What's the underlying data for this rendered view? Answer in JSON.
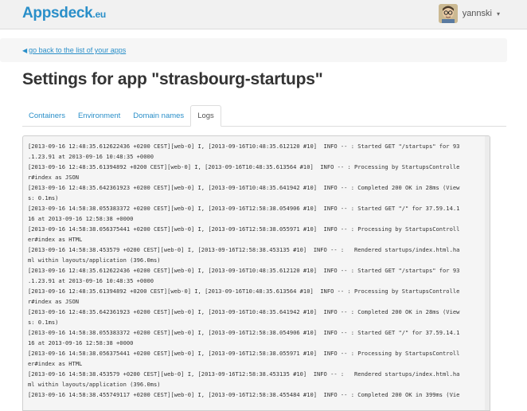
{
  "header": {
    "brand_name": "Appsdeck",
    "brand_tld": ".eu",
    "username": "yannski",
    "caret": "▾"
  },
  "nav": {
    "back_arrow": "◀",
    "back_label": "go back to the list of your apps"
  },
  "page": {
    "title": "Settings for app \"strasbourg-startups\""
  },
  "tabs": [
    {
      "label": "Containers",
      "active": false
    },
    {
      "label": "Environment",
      "active": false
    },
    {
      "label": "Domain names",
      "active": false
    },
    {
      "label": "Logs",
      "active": true
    }
  ],
  "logs": [
    "[2013-09-16 12:48:35.612622436 +0200 CEST][web-0] I, [2013-09-16T10:48:35.612120 #10]  INFO -- : Started GET \"/startups\" for 93",
    ".1.23.91 at 2013-09-16 10:48:35 +0000",
    "[2013-09-16 12:48:35.61394892 +0200 CEST][web-0] I, [2013-09-16T10:48:35.613564 #10]  INFO -- : Processing by StartupsControlle",
    "r#index as JSON",
    "[2013-09-16 12:48:35.642361923 +0200 CEST][web-0] I, [2013-09-16T10:48:35.641942 #10]  INFO -- : Completed 200 OK in 28ms (View",
    "s: 0.1ms)",
    "[2013-09-16 14:58:38.055383372 +0200 CEST][web-0] I, [2013-09-16T12:58:38.054906 #10]  INFO -- : Started GET \"/\" for 37.59.14.1",
    "16 at 2013-09-16 12:58:38 +0000",
    "[2013-09-16 14:58:38.056375441 +0200 CEST][web-0] I, [2013-09-16T12:58:38.055971 #10]  INFO -- : Processing by StartupsControll",
    "er#index as HTML",
    "[2013-09-16 14:58:38.453579 +0200 CEST][web-0] I, [2013-09-16T12:58:38.453135 #10]  INFO -- :   Rendered startups/index.html.ha",
    "ml within layouts/application (396.0ms)",
    "[2013-09-16 12:48:35.612622436 +0200 CEST][web-0] I, [2013-09-16T10:48:35.612120 #10]  INFO -- : Started GET \"/startups\" for 93",
    ".1.23.91 at 2013-09-16 10:48:35 +0000",
    "[2013-09-16 12:48:35.61394892 +0200 CEST][web-0] I, [2013-09-16T10:48:35.613564 #10]  INFO -- : Processing by StartupsControlle",
    "r#index as JSON",
    "[2013-09-16 12:48:35.642361923 +0200 CEST][web-0] I, [2013-09-16T10:48:35.641942 #10]  INFO -- : Completed 200 OK in 28ms (View",
    "s: 0.1ms)",
    "[2013-09-16 14:58:38.055383372 +0200 CEST][web-0] I, [2013-09-16T12:58:38.054906 #10]  INFO -- : Started GET \"/\" for 37.59.14.1",
    "16 at 2013-09-16 12:58:38 +0000",
    "[2013-09-16 14:58:38.056375441 +0200 CEST][web-0] I, [2013-09-16T12:58:38.055971 #10]  INFO -- : Processing by StartupsControll",
    "er#index as HTML",
    "[2013-09-16 14:58:38.453579 +0200 CEST][web-0] I, [2013-09-16T12:58:38.453135 #10]  INFO -- :   Rendered startups/index.html.ha",
    "ml within layouts/application (396.0ms)",
    "[2013-09-16 14:58:38.455749117 +0200 CEST][web-0] I, [2013-09-16T12:58:38.455484 #10]  INFO -- : Completed 200 OK in 399ms (Vie"
  ],
  "colors": {
    "accent": "#2a8fc9",
    "header_bg": "#f1f1f1",
    "log_bg": "#f5f5f5"
  },
  "icons": {
    "avatar": "avatar-icon",
    "back": "back-arrow-icon",
    "caret": "chevron-down-icon"
  }
}
